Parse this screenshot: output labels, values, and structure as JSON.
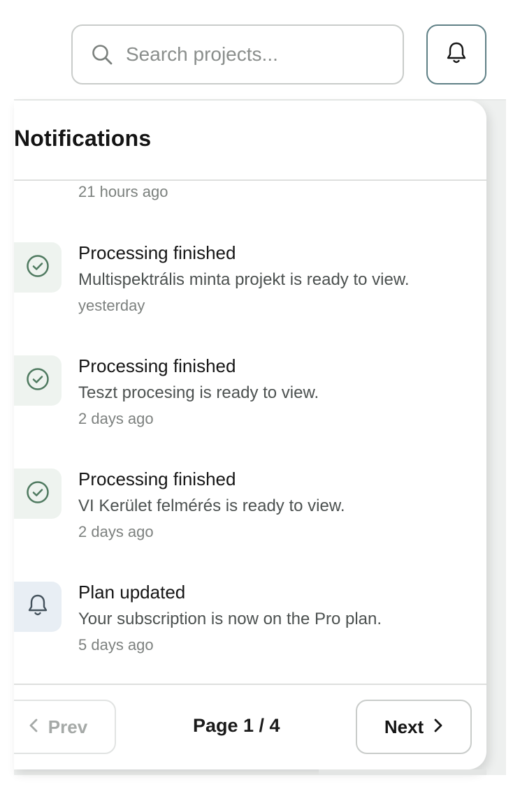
{
  "search": {
    "placeholder": "Search projects..."
  },
  "header": {
    "icon": "bell-icon"
  },
  "notifications": {
    "title": "Notifications",
    "partial_time": "21 hours ago",
    "items": [
      {
        "icon": "check-circle-icon",
        "title": "Processing finished",
        "message": "Multispektrális minta projekt is ready to view.",
        "time": "yesterday"
      },
      {
        "icon": "check-circle-icon",
        "title": "Processing finished",
        "message": "Teszt procesing is ready to view.",
        "time": "2 days ago"
      },
      {
        "icon": "check-circle-icon",
        "title": "Processing finished",
        "message": "VI Kerület felmérés is ready to view.",
        "time": "2 days ago"
      },
      {
        "icon": "bell-icon",
        "title": "Plan updated",
        "message": "Your subscription is now on the Pro plan.",
        "time": "5 days ago"
      }
    ]
  },
  "pagination": {
    "prev_label": "Prev",
    "page_label": "Page 1 / 4",
    "next_label": "Next"
  },
  "colors": {
    "accent_border": "#5f8086",
    "success_icon": "#4f7a60",
    "success_bg": "#eef3ef",
    "info_bg": "#e8eef4"
  }
}
